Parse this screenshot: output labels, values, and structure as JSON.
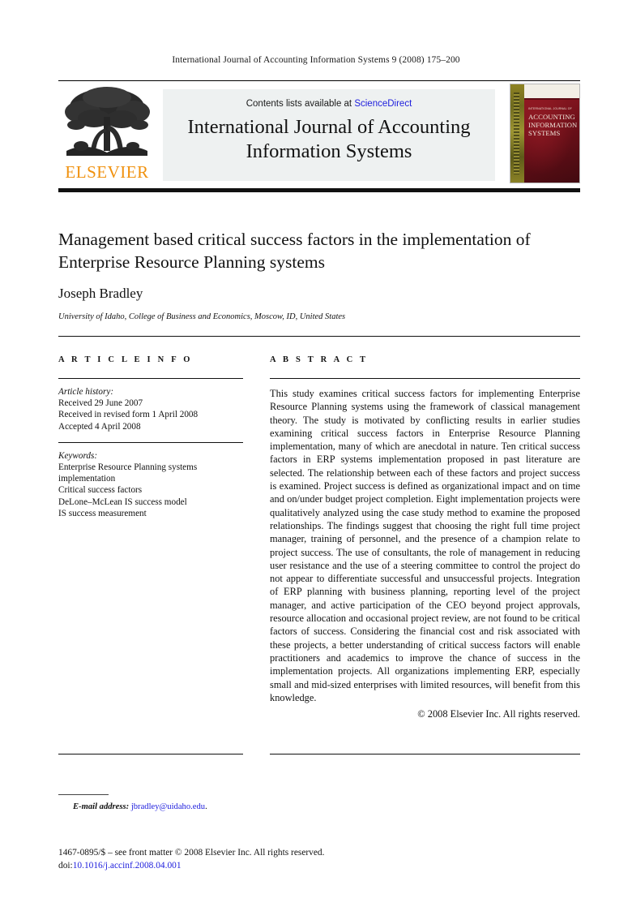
{
  "running_head": "International Journal of Accounting Information Systems 9 (2008) 175–200",
  "header": {
    "contents_prefix": "Contents lists available at ",
    "sciencedirect_label": "ScienceDirect",
    "journal_title_line1": "International Journal of Accounting",
    "journal_title_line2": "Information Systems",
    "publisher_wordmark": "ELSEVIER",
    "cover": {
      "issn_line": "INTERNATIONAL JOURNAL OF",
      "title_line1": "ACCOUNTING",
      "title_line2": "INFORMATION",
      "title_line3": "SYSTEMS"
    },
    "colors": {
      "panel_bg": "#eef1f1",
      "link_blue": "#2020dd",
      "elsevier_orange": "#f0910e",
      "cover_maroon": "#7c1420",
      "cover_spine_olive": "#8e8323"
    }
  },
  "article": {
    "title": "Management based critical success factors in the implementation of Enterprise Resource Planning systems",
    "author": "Joseph Bradley",
    "affiliation": "University of Idaho, College of Business and Economics, Moscow, ID, United States"
  },
  "info": {
    "heading": "A R T I C L E   I N F O",
    "history_label": "Article history:",
    "history": [
      "Received 29 June 2007",
      "Received in revised form 1 April 2008",
      "Accepted 4 April 2008"
    ],
    "keywords_label": "Keywords:",
    "keywords": [
      "Enterprise Resource Planning systems",
      "implementation",
      "Critical success factors",
      "DeLone–McLean IS success model",
      "IS success measurement"
    ]
  },
  "abstract": {
    "heading": "A B S T R A C T",
    "text": "This study examines critical success factors for implementing Enterprise Resource Planning systems using the framework of classical management theory. The study is motivated by conflicting results in earlier studies examining critical success factors in Enterprise Resource Planning implementation, many of which are anecdotal in nature. Ten critical success factors in ERP systems implementation proposed in past literature are selected. The relationship between each of these factors and project success is examined. Project success is defined as organizational impact and on time and on/under budget project completion. Eight implementation projects were qualitatively analyzed using the case study method to examine the proposed relationships. The findings suggest that choosing the right full time project manager, training of personnel, and the presence of a champion relate to project success. The use of consultants, the role of management in reducing user resistance and the use of a steering committee to control the project do not appear to differentiate successful and unsuccessful projects. Integration of ERP planning with business planning, reporting level of the project manager, and active participation of the CEO beyond project approvals, resource allocation and occasional project review, are not found to be critical factors of success. Considering the financial cost and risk associated with these projects, a better understanding of critical success factors will enable practitioners and academics to improve the chance of success in the implementation projects. All organizations implementing ERP, especially small and mid-sized enterprises with limited resources, will benefit from this knowledge.",
    "copyright": "© 2008 Elsevier Inc. All rights reserved."
  },
  "footer": {
    "email_label": "E-mail address:",
    "email_address": "jbradley@uidaho.edu",
    "email_trailing": ".",
    "front_matter": "1467-0895/$ – see front matter © 2008 Elsevier Inc. All rights reserved.",
    "doi_label": "doi:",
    "doi_value": "10.1016/j.accinf.2008.04.001"
  }
}
